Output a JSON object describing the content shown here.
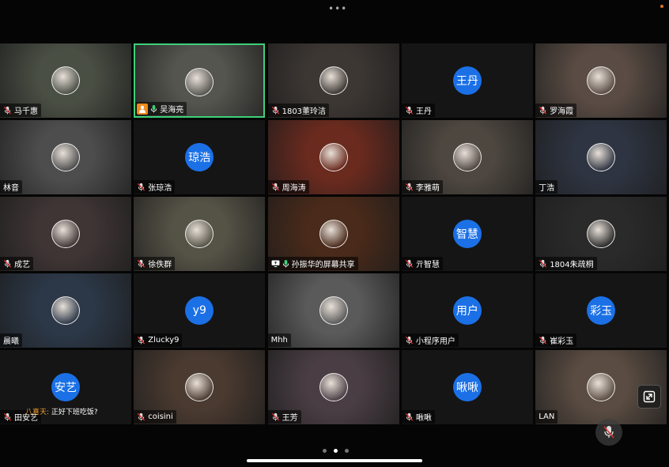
{
  "topbar": {
    "menu": "•••"
  },
  "participants": [
    {
      "name": "马千惠",
      "avatar": "avatar-image",
      "mic": "off",
      "bg": "#4a4f44"
    },
    {
      "name": "吴海亮",
      "avatar": "avatar-image",
      "mic": "on",
      "host": true,
      "active": true,
      "bg": "#55554f"
    },
    {
      "name": "1803董玲洁",
      "avatar": "avatar-image",
      "mic": "off",
      "bg": "#3d3733"
    },
    {
      "name": "王丹",
      "avatar": "王丹",
      "mic": "off",
      "bg": "#151515"
    },
    {
      "name": "罗海霞",
      "avatar": "avatar-image",
      "mic": "off",
      "bg": "#5a4c44"
    },
    {
      "name": "林音",
      "avatar": "avatar-image",
      "mic": "none",
      "bg": "#4d4d4d"
    },
    {
      "name": "张琼浩",
      "avatar": "琼浩",
      "mic": "off",
      "bg": "#151515"
    },
    {
      "name": "周海涛",
      "avatar": "avatar-image",
      "mic": "off",
      "bg": "#6a2a1e"
    },
    {
      "name": "李雅萌",
      "avatar": "avatar-image",
      "mic": "off",
      "bg": "#4e4740"
    },
    {
      "name": "丁浩",
      "avatar": "avatar-image",
      "mic": "none",
      "bg": "#2e3441"
    },
    {
      "name": "成艺",
      "avatar": "avatar-image",
      "mic": "off",
      "bg": "#3f3535"
    },
    {
      "name": "徐佚群",
      "avatar": "avatar-image",
      "mic": "off",
      "bg": "#555346"
    },
    {
      "name": "孙振华的屏幕共享",
      "avatar": "avatar-image",
      "mic": "on",
      "share": true,
      "bg": "#4a2a1a"
    },
    {
      "name": "亓智慧",
      "avatar": "智慧",
      "mic": "off",
      "bg": "#151515"
    },
    {
      "name": "1804朱疏桐",
      "avatar": "avatar-image",
      "mic": "off",
      "bg": "#2a2a2a"
    },
    {
      "name": "晨曦",
      "avatar": "avatar-image",
      "mic": "none",
      "bg": "#2c3848"
    },
    {
      "name": "Zlucky9",
      "avatar": "y9",
      "mic": "off",
      "bg": "#151515"
    },
    {
      "name": "Mhh",
      "avatar": "avatar-image",
      "mic": "none",
      "bg": "#5a5a5a"
    },
    {
      "name": "小程序用户",
      "avatar": "用户",
      "mic": "off",
      "bg": "#151515"
    },
    {
      "name": "崔彩玉",
      "avatar": "彩玉",
      "mic": "off",
      "bg": "#151515"
    },
    {
      "name": "田安艺",
      "avatar": "安艺",
      "mic": "off",
      "bg": "#151515"
    },
    {
      "name": "coisini",
      "avatar": "avatar-image",
      "mic": "off",
      "bg": "#4a3a30"
    },
    {
      "name": "王芳",
      "avatar": "avatar-image",
      "mic": "off",
      "bg": "#4a3e44"
    },
    {
      "name": "啾啾",
      "avatar": "啾啾",
      "mic": "off",
      "bg": "#151515"
    },
    {
      "name": "LAN",
      "avatar": "avatar-image",
      "mic": "none",
      "bg": "#5a4c42"
    }
  ],
  "chat": {
    "sender": "八喜天:",
    "message": "正好下班吃饭?"
  },
  "pagination": {
    "total": 3,
    "current": 2
  },
  "colors": {
    "avatar_blue": "#1b70e6",
    "active_border": "#3fd07a",
    "host_badge": "#f08a1e",
    "record_dot": "#e07020"
  }
}
